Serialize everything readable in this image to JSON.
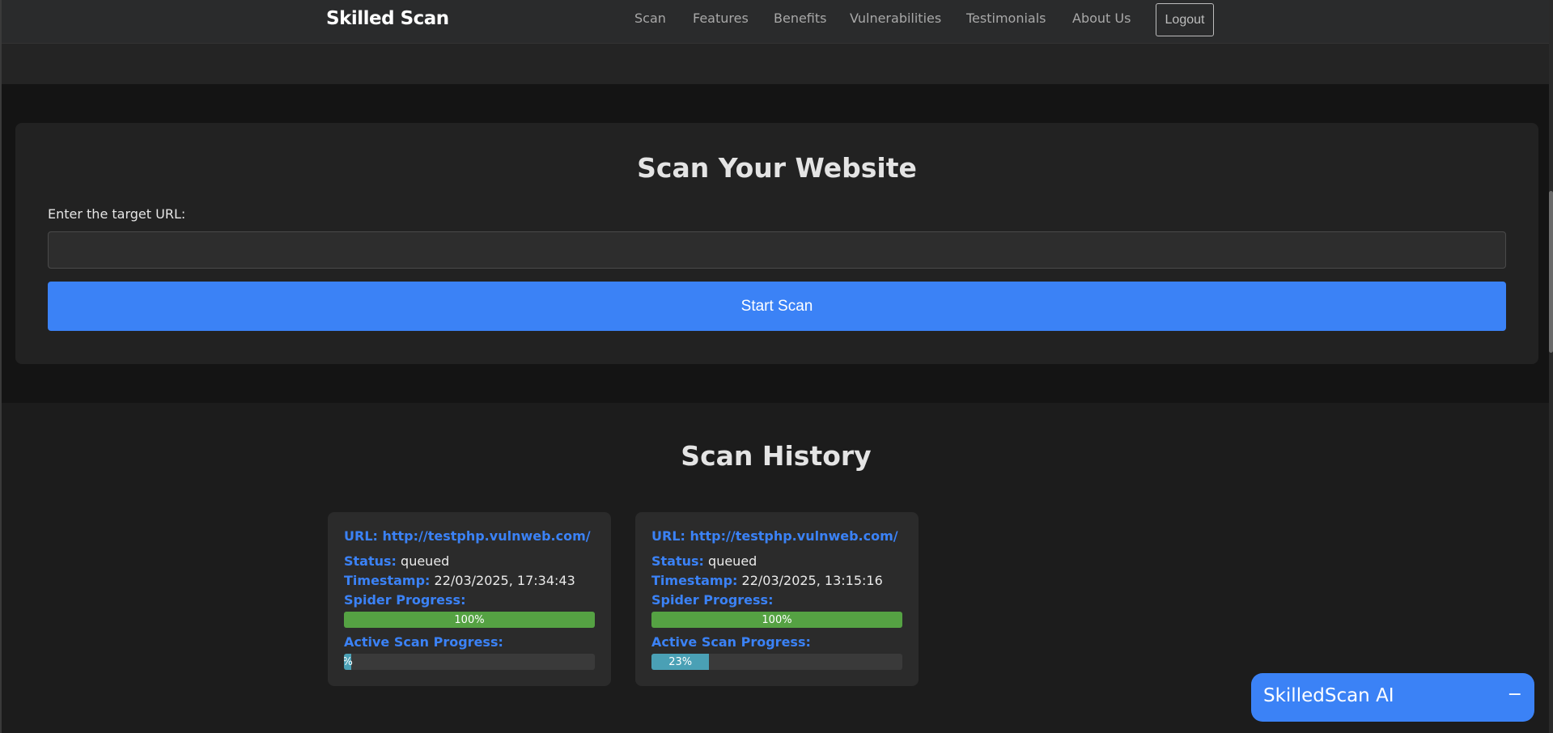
{
  "header": {
    "brand": "Skilled Scan",
    "nav": [
      {
        "label": "Scan",
        "name": "nav-scan"
      },
      {
        "label": "Features",
        "name": "nav-features"
      },
      {
        "label": "Benefits",
        "name": "nav-benefits"
      },
      {
        "label": "Vulnerabilities",
        "name": "nav-vulnerabilities"
      },
      {
        "label": "Testimonials",
        "name": "nav-testimonials"
      },
      {
        "label": "About Us",
        "name": "nav-about-us"
      }
    ],
    "logout_label": "Logout"
  },
  "scan": {
    "title": "Scan Your Website",
    "url_label": "Enter the target URL:",
    "url_value": "",
    "url_placeholder": "",
    "start_label": "Start Scan"
  },
  "history": {
    "title": "Scan History",
    "url_label": "URL:",
    "status_label": "Status:",
    "timestamp_label": "Timestamp:",
    "spider_label": "Spider Progress:",
    "active_label": "Active Scan Progress:",
    "items": [
      {
        "url": "http://testphp.vulnweb.com/",
        "status": "queued",
        "timestamp": "22/03/2025, 17:34:43",
        "spider_progress": 100,
        "spider_text": "100%",
        "active_progress": 3,
        "active_text": "%"
      },
      {
        "url": "http://testphp.vulnweb.com/",
        "status": "queued",
        "timestamp": "22/03/2025, 13:15:16",
        "spider_progress": 100,
        "spider_text": "100%",
        "active_progress": 23,
        "active_text": "23%"
      }
    ]
  },
  "chat": {
    "title": "SkilledScan AI",
    "minimize_label": "−"
  },
  "colors": {
    "accent": "#3b82f6",
    "progress_green": "#55a243",
    "progress_teal": "#4aa0b5"
  }
}
